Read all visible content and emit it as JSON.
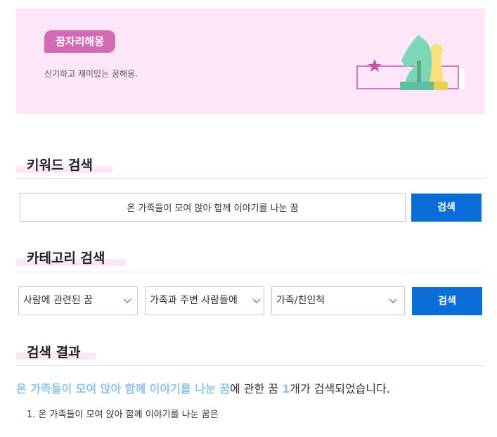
{
  "banner": {
    "badge": "꿈자리해몽",
    "subtitle": "신기하고 재미있는 꿈해몽.",
    "art_icon": "chess-knight-pawn-icon",
    "colors": {
      "background": "#fde6f6",
      "badge": "#d36bb4",
      "knight": "#7dd6b8",
      "pawn": "#f7e27a",
      "star": "#c755a5"
    }
  },
  "keyword_search": {
    "title": "키워드 검색",
    "input_value": "온 가족들이 모여 앉아 함께 이야기를 나눈 꿈",
    "button_label": "검색"
  },
  "category_search": {
    "title": "카테고리 검색",
    "select_1": "사람에 관련된 꿈",
    "select_2": "가족과 주변 사람들에",
    "select_3": "가족/친인척",
    "button_label": "검색"
  },
  "results": {
    "title": "검색 결과",
    "query_highlight": "온 가족들이 모여 앉아 함께 이야기를 나눈 꿈",
    "summary_middle": "에 관한 꿈 ",
    "count": "1",
    "summary_end": "개가 검색되었습니다.",
    "items": [
      "1. 온 가족들이 모여 앉아 함께 이야기를 나눈 꿈은"
    ]
  },
  "colors": {
    "primary_button": "#0a6dd8",
    "highlight_text": "#8fc3e6"
  }
}
